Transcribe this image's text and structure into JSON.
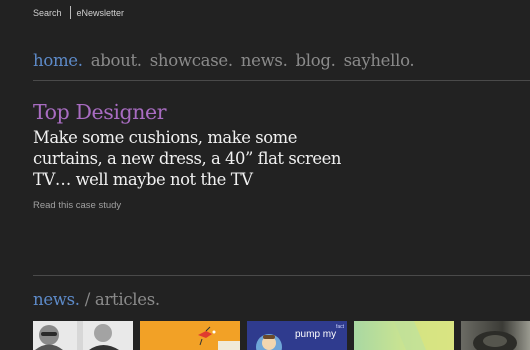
{
  "topbar": {
    "search": "Search",
    "enewsletter": "eNewsletter"
  },
  "nav": {
    "items": [
      {
        "label": "home.",
        "active": true
      },
      {
        "label": "about.",
        "active": false
      },
      {
        "label": "showcase.",
        "active": false
      },
      {
        "label": "news.",
        "active": false
      },
      {
        "label": "blog.",
        "active": false
      },
      {
        "label": "sayhello.",
        "active": false
      }
    ]
  },
  "feature": {
    "title": "Top Designer",
    "body": "Make some cushions, make some curtains, a new dress, a 40” flat screen TV… well maybe not the TV",
    "link": "Read this case study"
  },
  "news_section": {
    "heading_news": "news.",
    "separator": "/",
    "heading_articles": "articles."
  },
  "thumbnails": {
    "t3_text": "pump my",
    "t3_tag": "fact"
  },
  "colors": {
    "background": "#222222",
    "nav_active": "#5d8ac8",
    "nav_inactive": "#8a8a8a",
    "feature_title": "#a86cc1",
    "body_text": "#f0f0f0"
  }
}
